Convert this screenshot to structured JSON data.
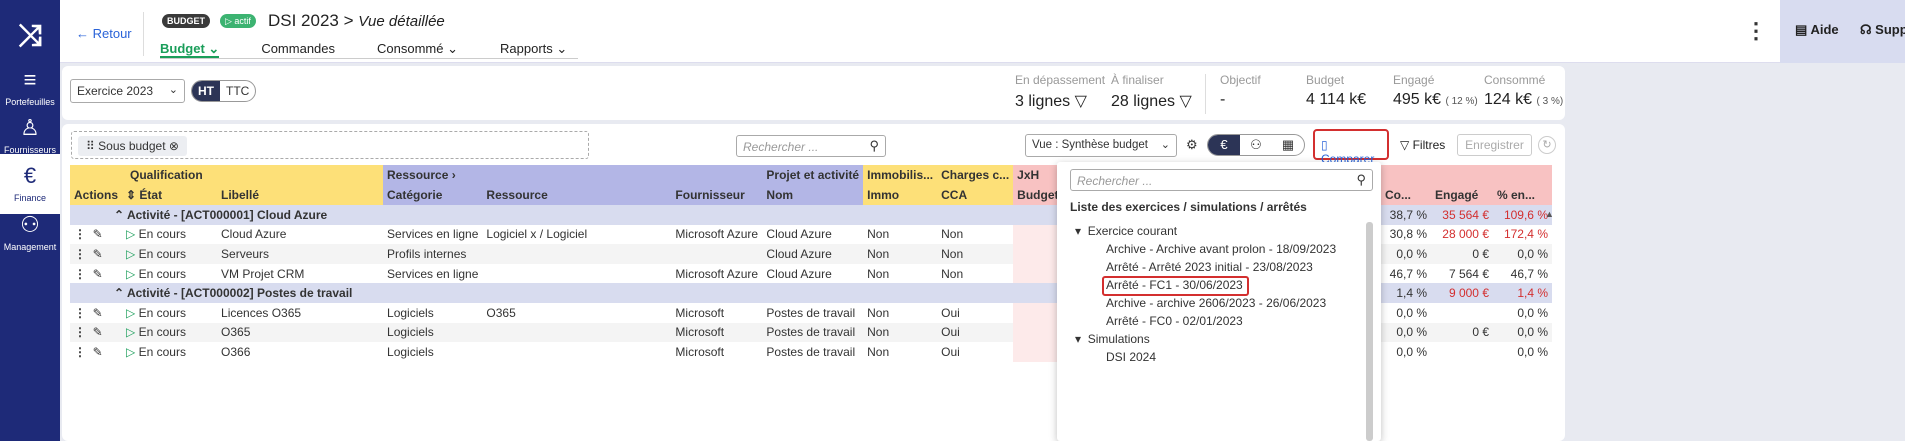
{
  "app": {
    "logo_icon": "logo-icon"
  },
  "sidebar": {
    "items": [
      {
        "label": "Portefeuilles",
        "icon": "portfolio-icon"
      },
      {
        "label": "Fournisseurs",
        "icon": "supplier-icon"
      },
      {
        "label": "Finance",
        "icon": "euro-icon"
      },
      {
        "label": "Management",
        "icon": "users-icon"
      }
    ]
  },
  "header": {
    "back_label": "← Retour",
    "badge_budget": "BUDGET",
    "badge_actif": "▷ actif",
    "title": "DSI 2023",
    "title_sep": ">",
    "subtitle": "Vue détaillée",
    "tabs": [
      "Budget",
      "Commandes",
      "Consommé",
      "Rapports"
    ],
    "help_label": "Aide",
    "support_label": "Support"
  },
  "toolbar": {
    "exercice": "Exercice 2023",
    "ht": "HT",
    "ttc": "TTC"
  },
  "kpis": [
    {
      "label": "En dépassement",
      "value": "3 lignes",
      "suffix": ""
    },
    {
      "label": "À finaliser",
      "value": "28 lignes",
      "suffix": ""
    },
    {
      "label": "Objectif",
      "value": "-",
      "suffix": ""
    },
    {
      "label": "Budget",
      "value": "4 114 k€",
      "suffix": ""
    },
    {
      "label": "Engagé",
      "value": "495 k€",
      "suffix": "( 12 %)"
    },
    {
      "label": "Consommé",
      "value": "124 k€",
      "suffix": "( 3 %)"
    }
  ],
  "filterbar": {
    "sous_budget": "Sous budget",
    "search_placeholder": "Rechercher ...",
    "vue": "Vue : Synthèse budget",
    "comparer": "Comparer",
    "filtres": "Filtres",
    "enregistrer": "Enregistrer"
  },
  "table": {
    "groups": {
      "qualification": "Qualification",
      "ressource": "Ressource",
      "projet": "Projet et activité",
      "immo": "Immobilis...",
      "charges": "Charges c...",
      "jxh": "JxH"
    },
    "headers": [
      "Actions",
      "État",
      "Libellé",
      "Catégorie",
      "Ressource",
      "Fournisseur",
      "Nom",
      "Immo",
      "CCA",
      "Budget"
    ],
    "right_headers": [
      "Co...",
      "Engagé",
      "% en..."
    ],
    "rows": [
      {
        "type": "group",
        "label": "Activité - [ACT000001] Cloud Azure",
        "pct1": "38,7 %",
        "eng": "35 564 €",
        "pct2": "109,6 %"
      },
      {
        "type": "row",
        "etat": "En cours",
        "libelle": "Cloud Azure",
        "cat": "Services en ligne",
        "res": "Logiciel x / Logiciel",
        "four": "Microsoft Azure",
        "nom": "Cloud Azure",
        "immo": "Non",
        "cca": "Non",
        "pct1": "30,8 %",
        "eng": "28 000 €",
        "pct2": "172,4 %"
      },
      {
        "type": "row",
        "etat": "En cours",
        "libelle": "Serveurs",
        "cat": "Profils internes",
        "res": "",
        "four": "",
        "nom": "Cloud Azure",
        "immo": "Non",
        "cca": "Non",
        "pct1": "0,0 %",
        "eng": "0 €",
        "pct2": "0,0 %"
      },
      {
        "type": "row",
        "etat": "En cours",
        "libelle": "VM Projet CRM",
        "cat": "Services en ligne",
        "res": "",
        "four": "Microsoft Azure",
        "nom": "Cloud Azure",
        "immo": "Non",
        "cca": "Non",
        "pct1": "46,7 %",
        "eng": "7 564 €",
        "pct2": "46,7 %"
      },
      {
        "type": "group",
        "label": "Activité - [ACT000002] Postes de travail",
        "pct1": "1,4 %",
        "eng": "9 000 €",
        "pct2": "1,4 %"
      },
      {
        "type": "row",
        "etat": "En cours",
        "libelle": "Licences O365",
        "cat": "Logiciels",
        "res": "O365",
        "four": "Microsoft",
        "nom": "Postes de travail",
        "immo": "Non",
        "cca": "Oui",
        "pct1": "0,0 %",
        "eng": "",
        "pct2": "0,0 %"
      },
      {
        "type": "row",
        "etat": "En cours",
        "libelle": "O365",
        "cat": "Logiciels",
        "res": "",
        "four": "Microsoft",
        "nom": "Postes de travail",
        "immo": "Non",
        "cca": "Oui",
        "pct1": "0,0 %",
        "eng": "0 €",
        "pct2": "0,0 %"
      },
      {
        "type": "row",
        "etat": "En cours",
        "libelle": "O366",
        "cat": "Logiciels",
        "res": "",
        "four": "Microsoft",
        "nom": "Postes de travail",
        "immo": "Non",
        "cca": "Oui",
        "pct1": "0,0 %",
        "eng": "",
        "pct2": "0,0 %"
      }
    ]
  },
  "dropdown": {
    "search_placeholder": "Rechercher ...",
    "title": "Liste des exercices / simulations / arrêtés",
    "section1": "Exercice courant",
    "items": [
      "Archive - Archive avant prolon - 18/09/2023",
      "Arrêté - Arrêté 2023 initial - 23/08/2023",
      "Arrêté - FC1 - 30/06/2023",
      "Archive - archive 2606/2023 - 26/06/2023",
      "Arrêté - FC0 - 02/01/2023"
    ],
    "section2": "Simulations",
    "sim_items": [
      "DSI 2024"
    ]
  }
}
